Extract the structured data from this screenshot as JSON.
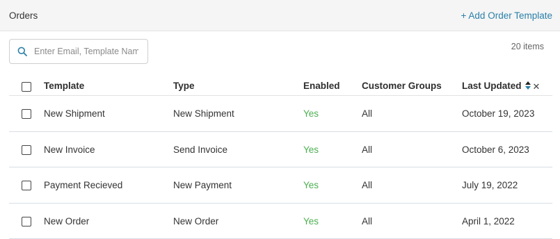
{
  "header": {
    "title": "Orders",
    "add_template_label": "+ Add Order Template"
  },
  "search": {
    "placeholder": "Enter Email, Template Name",
    "value": ""
  },
  "item_count": "20 items",
  "table": {
    "columns": {
      "template": "Template",
      "type": "Type",
      "enabled": "Enabled",
      "customer_groups": "Customer Groups",
      "last_updated": "Last Updated"
    },
    "rows": [
      {
        "template": "New Shipment",
        "type": "New Shipment",
        "enabled": "Yes",
        "customer_groups": "All",
        "last_updated": "October 19, 2023"
      },
      {
        "template": "New Invoice",
        "type": "Send Invoice",
        "enabled": "Yes",
        "customer_groups": "All",
        "last_updated": "October 6, 2023"
      },
      {
        "template": "Payment Recieved",
        "type": "New Payment",
        "enabled": "Yes",
        "customer_groups": "All",
        "last_updated": "July 19, 2022"
      },
      {
        "template": "New Order",
        "type": "New Order",
        "enabled": "Yes",
        "customer_groups": "All",
        "last_updated": "April 1, 2022"
      }
    ]
  },
  "icons": {
    "search": "search-icon",
    "sort": "sort-icon",
    "clear_sort": "close-icon"
  },
  "colors": {
    "accent": "#2a7fa8",
    "enabled_yes": "#4caf50",
    "sort_up": "#222222",
    "sort_down": "#2a7fa8"
  }
}
